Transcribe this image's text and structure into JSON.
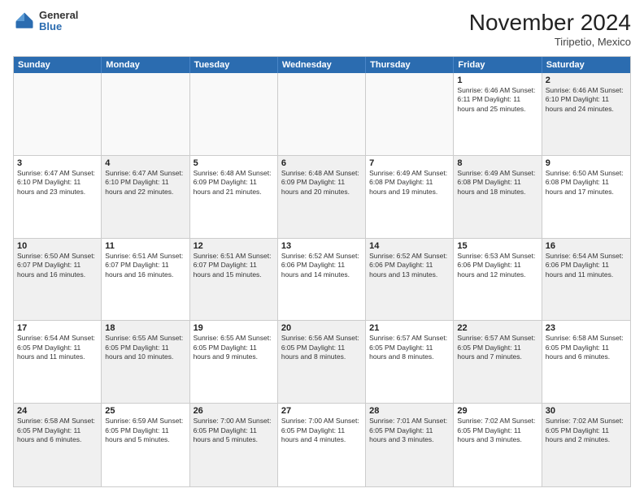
{
  "header": {
    "logo_general": "General",
    "logo_blue": "Blue",
    "month_title": "November 2024",
    "location": "Tiripetio, Mexico"
  },
  "weekdays": [
    "Sunday",
    "Monday",
    "Tuesday",
    "Wednesday",
    "Thursday",
    "Friday",
    "Saturday"
  ],
  "rows": [
    [
      {
        "day": "",
        "info": "",
        "empty": true
      },
      {
        "day": "",
        "info": "",
        "empty": true
      },
      {
        "day": "",
        "info": "",
        "empty": true
      },
      {
        "day": "",
        "info": "",
        "empty": true
      },
      {
        "day": "",
        "info": "",
        "empty": true
      },
      {
        "day": "1",
        "info": "Sunrise: 6:46 AM\nSunset: 6:11 PM\nDaylight: 11 hours\nand 25 minutes."
      },
      {
        "day": "2",
        "info": "Sunrise: 6:46 AM\nSunset: 6:10 PM\nDaylight: 11 hours\nand 24 minutes.",
        "shaded": true
      }
    ],
    [
      {
        "day": "3",
        "info": "Sunrise: 6:47 AM\nSunset: 6:10 PM\nDaylight: 11 hours\nand 23 minutes."
      },
      {
        "day": "4",
        "info": "Sunrise: 6:47 AM\nSunset: 6:10 PM\nDaylight: 11 hours\nand 22 minutes.",
        "shaded": true
      },
      {
        "day": "5",
        "info": "Sunrise: 6:48 AM\nSunset: 6:09 PM\nDaylight: 11 hours\nand 21 minutes."
      },
      {
        "day": "6",
        "info": "Sunrise: 6:48 AM\nSunset: 6:09 PM\nDaylight: 11 hours\nand 20 minutes.",
        "shaded": true
      },
      {
        "day": "7",
        "info": "Sunrise: 6:49 AM\nSunset: 6:08 PM\nDaylight: 11 hours\nand 19 minutes."
      },
      {
        "day": "8",
        "info": "Sunrise: 6:49 AM\nSunset: 6:08 PM\nDaylight: 11 hours\nand 18 minutes.",
        "shaded": true
      },
      {
        "day": "9",
        "info": "Sunrise: 6:50 AM\nSunset: 6:08 PM\nDaylight: 11 hours\nand 17 minutes."
      }
    ],
    [
      {
        "day": "10",
        "info": "Sunrise: 6:50 AM\nSunset: 6:07 PM\nDaylight: 11 hours\nand 16 minutes.",
        "shaded": true
      },
      {
        "day": "11",
        "info": "Sunrise: 6:51 AM\nSunset: 6:07 PM\nDaylight: 11 hours\nand 16 minutes."
      },
      {
        "day": "12",
        "info": "Sunrise: 6:51 AM\nSunset: 6:07 PM\nDaylight: 11 hours\nand 15 minutes.",
        "shaded": true
      },
      {
        "day": "13",
        "info": "Sunrise: 6:52 AM\nSunset: 6:06 PM\nDaylight: 11 hours\nand 14 minutes."
      },
      {
        "day": "14",
        "info": "Sunrise: 6:52 AM\nSunset: 6:06 PM\nDaylight: 11 hours\nand 13 minutes.",
        "shaded": true
      },
      {
        "day": "15",
        "info": "Sunrise: 6:53 AM\nSunset: 6:06 PM\nDaylight: 11 hours\nand 12 minutes."
      },
      {
        "day": "16",
        "info": "Sunrise: 6:54 AM\nSunset: 6:06 PM\nDaylight: 11 hours\nand 11 minutes.",
        "shaded": true
      }
    ],
    [
      {
        "day": "17",
        "info": "Sunrise: 6:54 AM\nSunset: 6:05 PM\nDaylight: 11 hours\nand 11 minutes."
      },
      {
        "day": "18",
        "info": "Sunrise: 6:55 AM\nSunset: 6:05 PM\nDaylight: 11 hours\nand 10 minutes.",
        "shaded": true
      },
      {
        "day": "19",
        "info": "Sunrise: 6:55 AM\nSunset: 6:05 PM\nDaylight: 11 hours\nand 9 minutes."
      },
      {
        "day": "20",
        "info": "Sunrise: 6:56 AM\nSunset: 6:05 PM\nDaylight: 11 hours\nand 8 minutes.",
        "shaded": true
      },
      {
        "day": "21",
        "info": "Sunrise: 6:57 AM\nSunset: 6:05 PM\nDaylight: 11 hours\nand 8 minutes."
      },
      {
        "day": "22",
        "info": "Sunrise: 6:57 AM\nSunset: 6:05 PM\nDaylight: 11 hours\nand 7 minutes.",
        "shaded": true
      },
      {
        "day": "23",
        "info": "Sunrise: 6:58 AM\nSunset: 6:05 PM\nDaylight: 11 hours\nand 6 minutes."
      }
    ],
    [
      {
        "day": "24",
        "info": "Sunrise: 6:58 AM\nSunset: 6:05 PM\nDaylight: 11 hours\nand 6 minutes.",
        "shaded": true
      },
      {
        "day": "25",
        "info": "Sunrise: 6:59 AM\nSunset: 6:05 PM\nDaylight: 11 hours\nand 5 minutes."
      },
      {
        "day": "26",
        "info": "Sunrise: 7:00 AM\nSunset: 6:05 PM\nDaylight: 11 hours\nand 5 minutes.",
        "shaded": true
      },
      {
        "day": "27",
        "info": "Sunrise: 7:00 AM\nSunset: 6:05 PM\nDaylight: 11 hours\nand 4 minutes."
      },
      {
        "day": "28",
        "info": "Sunrise: 7:01 AM\nSunset: 6:05 PM\nDaylight: 11 hours\nand 3 minutes.",
        "shaded": true
      },
      {
        "day": "29",
        "info": "Sunrise: 7:02 AM\nSunset: 6:05 PM\nDaylight: 11 hours\nand 3 minutes."
      },
      {
        "day": "30",
        "info": "Sunrise: 7:02 AM\nSunset: 6:05 PM\nDaylight: 11 hours\nand 2 minutes.",
        "shaded": true
      }
    ]
  ]
}
